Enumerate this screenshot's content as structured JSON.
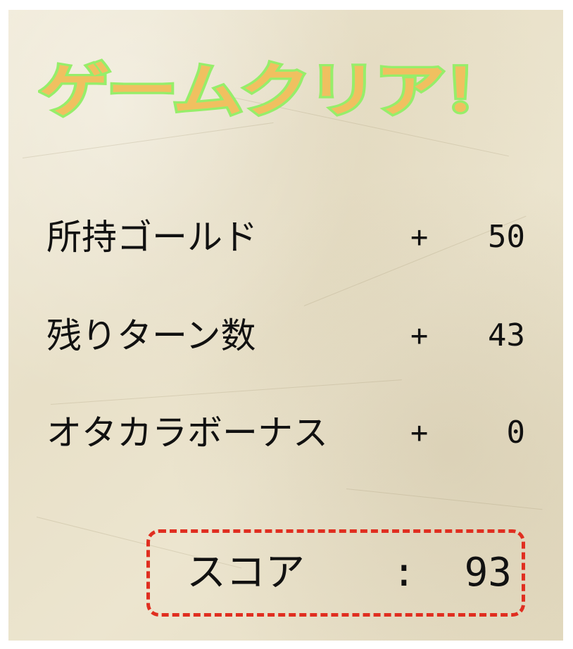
{
  "title": "ゲームクリア！",
  "rows": [
    {
      "label": "所持ゴールド",
      "sign": "+",
      "value": "50"
    },
    {
      "label": "残りターン数",
      "sign": "+",
      "value": "43"
    },
    {
      "label": "オタカラボーナス",
      "sign": "+",
      "value": "0"
    }
  ],
  "score": {
    "label": "スコア",
    "separator": ":",
    "value": "93"
  },
  "colors": {
    "title_fill": "#f0c060",
    "title_outline": "#96ee6a",
    "score_border": "#e02e20",
    "text": "#111111",
    "paper": "#ece5cf"
  }
}
